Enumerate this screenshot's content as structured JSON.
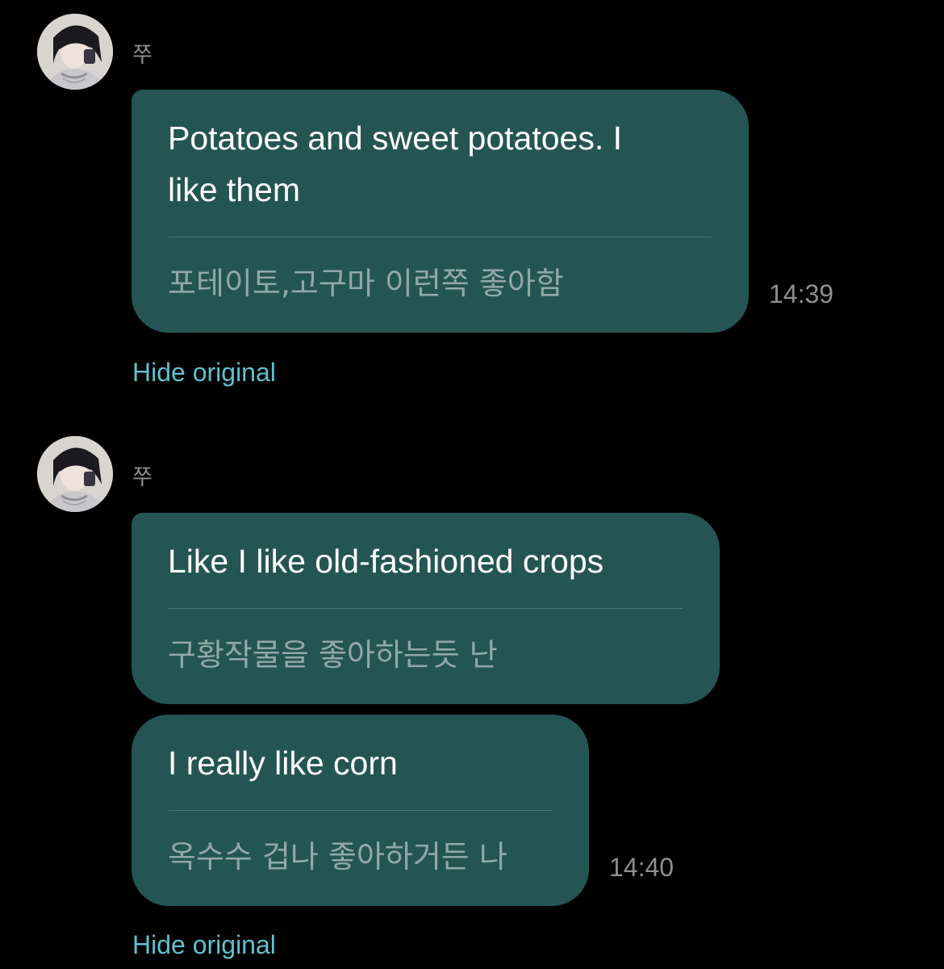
{
  "groups": [
    {
      "sender": "쭈",
      "messages": [
        {
          "translated": "Potatoes and sweet potatoes. I\nlike them",
          "original": "포테이토,고구마 이런쪽 좋아함",
          "time": "14:39"
        }
      ],
      "hide_original_label": "Hide original"
    },
    {
      "sender": "쭈",
      "messages": [
        {
          "translated": "Like I like old-fashioned crops",
          "original": "구황작물을 좋아하는듯 난"
        },
        {
          "translated": "I really like corn",
          "original": "옥수수 겁나 좋아하거든 나",
          "time": "14:40"
        }
      ],
      "hide_original_label": "Hide original"
    }
  ],
  "colors": {
    "background": "#000000",
    "bubble": "#245553",
    "link": "#5fc1cf",
    "timestamp": "#8e8e8e"
  }
}
